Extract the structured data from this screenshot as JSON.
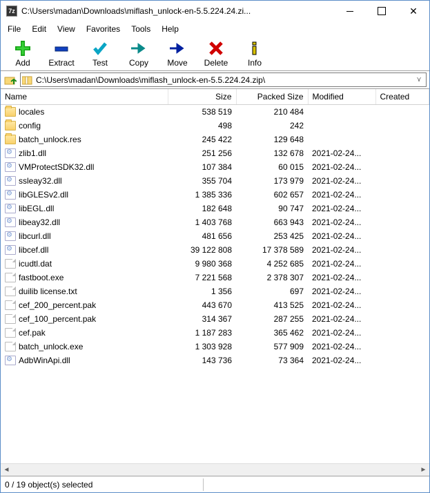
{
  "window": {
    "title": "C:\\Users\\madan\\Downloads\\miflash_unlock-en-5.5.224.24.zi..."
  },
  "menu": {
    "file": "File",
    "edit": "Edit",
    "view": "View",
    "favorites": "Favorites",
    "tools": "Tools",
    "help": "Help"
  },
  "toolbar": {
    "add": "Add",
    "extract": "Extract",
    "test": "Test",
    "copy": "Copy",
    "move": "Move",
    "delete": "Delete",
    "info": "Info"
  },
  "path": "C:\\Users\\madan\\Downloads\\miflash_unlock-en-5.5.224.24.zip\\",
  "columns": {
    "name": "Name",
    "size": "Size",
    "packed": "Packed Size",
    "modified": "Modified",
    "created": "Created"
  },
  "rows": [
    {
      "icon": "folder",
      "name": "locales",
      "size": "538 519",
      "packed": "210 484",
      "modified": ""
    },
    {
      "icon": "folder",
      "name": "config",
      "size": "498",
      "packed": "242",
      "modified": ""
    },
    {
      "icon": "folder",
      "name": "batch_unlock.res",
      "size": "245 422",
      "packed": "129 648",
      "modified": ""
    },
    {
      "icon": "dll",
      "name": "zlib1.dll",
      "size": "251 256",
      "packed": "132 678",
      "modified": "2021-02-24..."
    },
    {
      "icon": "dll",
      "name": "VMProtectSDK32.dll",
      "size": "107 384",
      "packed": "60 015",
      "modified": "2021-02-24..."
    },
    {
      "icon": "dll",
      "name": "ssleay32.dll",
      "size": "355 704",
      "packed": "173 979",
      "modified": "2021-02-24..."
    },
    {
      "icon": "dll",
      "name": "libGLESv2.dll",
      "size": "1 385 336",
      "packed": "602 657",
      "modified": "2021-02-24..."
    },
    {
      "icon": "dll",
      "name": "libEGL.dll",
      "size": "182 648",
      "packed": "90 747",
      "modified": "2021-02-24..."
    },
    {
      "icon": "dll",
      "name": "libeay32.dll",
      "size": "1 403 768",
      "packed": "663 943",
      "modified": "2021-02-24..."
    },
    {
      "icon": "dll",
      "name": "libcurl.dll",
      "size": "481 656",
      "packed": "253 425",
      "modified": "2021-02-24..."
    },
    {
      "icon": "dll",
      "name": "libcef.dll",
      "size": "39 122 808",
      "packed": "17 378 589",
      "modified": "2021-02-24..."
    },
    {
      "icon": "doc",
      "name": "icudtl.dat",
      "size": "9 980 368",
      "packed": "4 252 685",
      "modified": "2021-02-24..."
    },
    {
      "icon": "doc",
      "name": "fastboot.exe",
      "size": "7 221 568",
      "packed": "2 378 307",
      "modified": "2021-02-24..."
    },
    {
      "icon": "doc",
      "name": "duilib license.txt",
      "size": "1 356",
      "packed": "697",
      "modified": "2021-02-24..."
    },
    {
      "icon": "doc",
      "name": "cef_200_percent.pak",
      "size": "443 670",
      "packed": "413 525",
      "modified": "2021-02-24..."
    },
    {
      "icon": "doc",
      "name": "cef_100_percent.pak",
      "size": "314 367",
      "packed": "287 255",
      "modified": "2021-02-24..."
    },
    {
      "icon": "doc",
      "name": "cef.pak",
      "size": "1 187 283",
      "packed": "365 462",
      "modified": "2021-02-24..."
    },
    {
      "icon": "doc",
      "name": "batch_unlock.exe",
      "size": "1 303 928",
      "packed": "577 909",
      "modified": "2021-02-24..."
    },
    {
      "icon": "dll",
      "name": "AdbWinApi.dll",
      "size": "143 736",
      "packed": "73 364",
      "modified": "2021-02-24..."
    }
  ],
  "status": "0 / 19 object(s) selected"
}
